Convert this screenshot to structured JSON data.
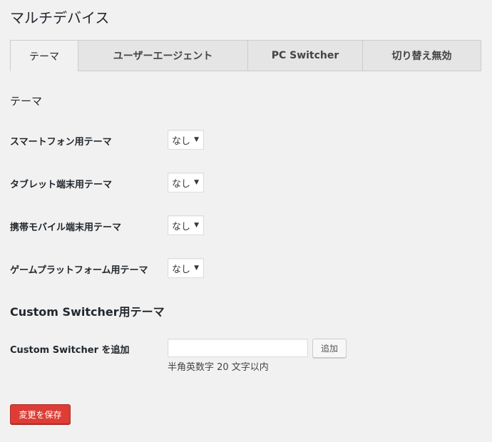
{
  "page": {
    "title": "マルチデバイス"
  },
  "tabs": [
    {
      "label": "テーマ"
    },
    {
      "label": "ユーザーエージェント"
    },
    {
      "label": "PC Switcher"
    },
    {
      "label": "切り替え無効"
    }
  ],
  "theme_section": {
    "heading": "テーマ",
    "rows": [
      {
        "label": "スマートフォン用テーマ",
        "value": "なし"
      },
      {
        "label": "タブレット端末用テーマ",
        "value": "なし"
      },
      {
        "label": "携帯モバイル端末用テーマ",
        "value": "なし"
      },
      {
        "label": "ゲームプラットフォーム用テーマ",
        "value": "なし"
      }
    ],
    "select_arrow": "▼"
  },
  "custom_section": {
    "heading": "Custom Switcher用テーマ",
    "add_label": "Custom Switcher を追加",
    "input_value": "",
    "add_button": "追加",
    "hint": "半角英数字 20 文字以内"
  },
  "save_button": "変更を保存",
  "colors": {
    "save_button_bg": "#dd3d36",
    "background": "#f1f1f1"
  }
}
